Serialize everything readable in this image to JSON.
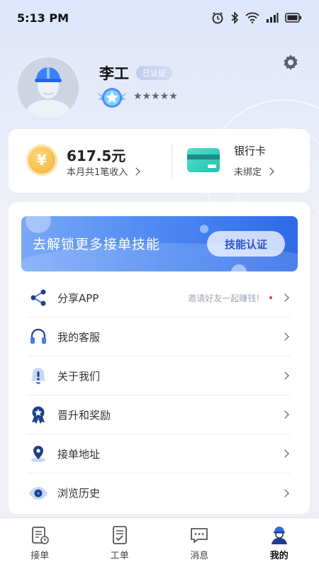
{
  "status_bar": {
    "time": "5:13 PM"
  },
  "profile": {
    "name": "李工",
    "verified_label": "已认证",
    "stars": "★★★★★"
  },
  "wallet": {
    "income_amount": "617.5元",
    "income_sub": "本月共1笔收入",
    "bank_title": "银行卡",
    "bank_status": "未绑定"
  },
  "banner": {
    "text": "去解锁更多接单技能",
    "button_label": "技能认证"
  },
  "menu": {
    "items": [
      {
        "label": "分享APP",
        "extra": "邀请好友一起赚钱!"
      },
      {
        "label": "我的客服"
      },
      {
        "label": "关于我们"
      },
      {
        "label": "晋升和奖励"
      },
      {
        "label": "接单地址"
      },
      {
        "label": "浏览历史"
      }
    ]
  },
  "tabbar": {
    "items": [
      {
        "label": "接单"
      },
      {
        "label": "工单"
      },
      {
        "label": "消息"
      },
      {
        "label": "我的"
      }
    ],
    "active": "我的"
  },
  "colors": {
    "accent": "#2f6ae8",
    "banner_start": "#79a9f8",
    "coin": "#f2ab2c",
    "card": "#27c0b0",
    "red_dot": "#ff3333"
  }
}
